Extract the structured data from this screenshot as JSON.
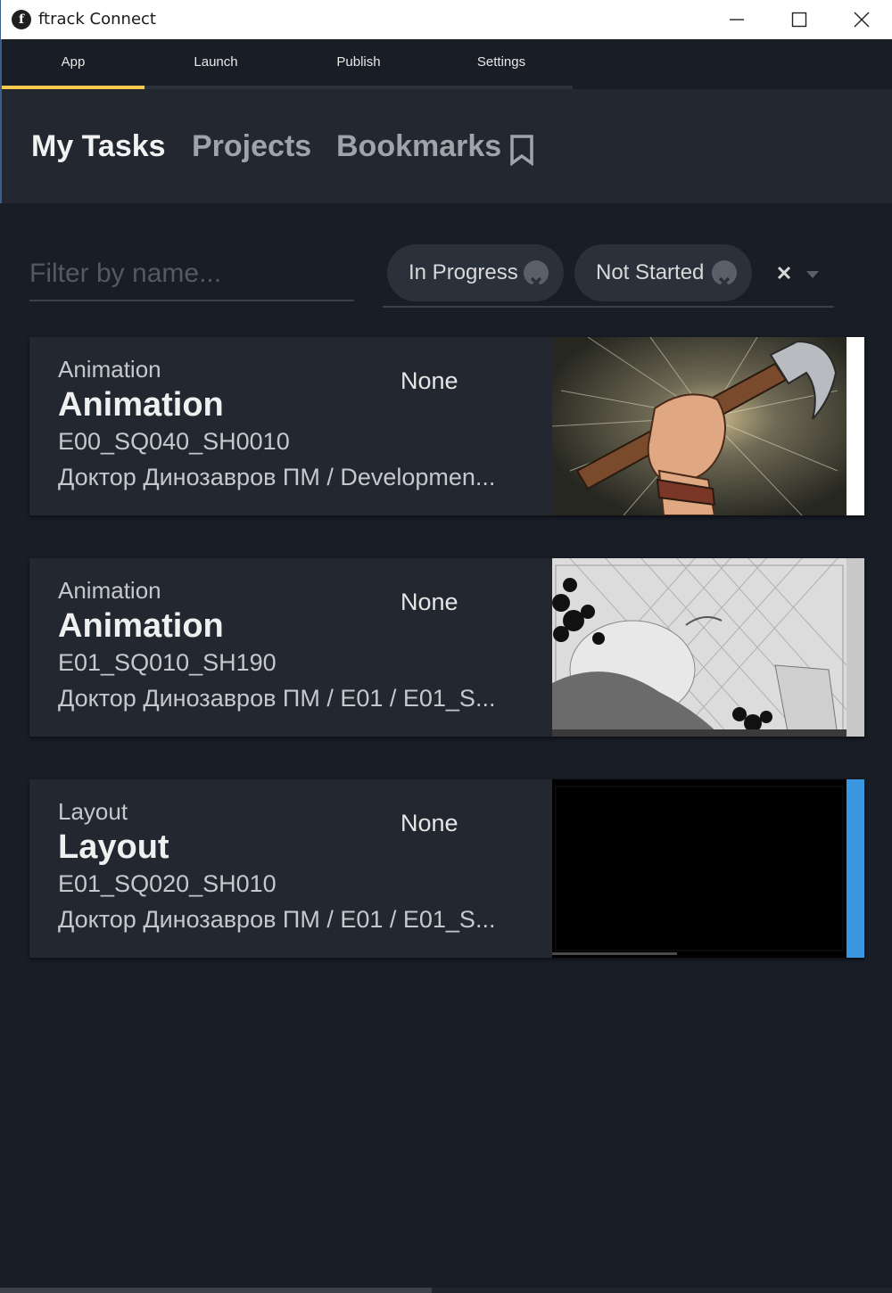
{
  "window": {
    "title": "ftrack Connect",
    "logo_letter": "f"
  },
  "tabs": [
    {
      "label": "App",
      "active": true
    },
    {
      "label": "Launch",
      "active": false
    },
    {
      "label": "Publish",
      "active": false
    },
    {
      "label": "Settings",
      "active": false
    }
  ],
  "subtabs": {
    "my_tasks": "My Tasks",
    "projects": "Projects",
    "bookmarks": "Bookmarks"
  },
  "filter": {
    "placeholder": "Filter by name...",
    "value": ""
  },
  "status_filters": [
    {
      "label": "In Progress"
    },
    {
      "label": "Not Started"
    }
  ],
  "tasks": [
    {
      "type": "Animation",
      "name": "Animation",
      "shot": "E00_SQ040_SH0010",
      "path": "Доктор Динозавров ПМ / Developmen...",
      "assignee": "None",
      "status_color": "#ffffff",
      "thumbnail": "hammer-fist"
    },
    {
      "type": "Animation",
      "name": "Animation",
      "shot": "E01_SQ010_SH190",
      "path": "Доктор Динозавров ПМ / E01 / E01_S...",
      "assignee": "None",
      "status_color": "#c8c8c8",
      "thumbnail": "sketch-frame"
    },
    {
      "type": "Layout",
      "name": "Layout",
      "shot": "E01_SQ020_SH010",
      "path": "Доктор Динозавров ПМ / E01 / E01_S...",
      "assignee": "None",
      "status_color": "#3a97e0",
      "thumbnail": "black-frame"
    }
  ],
  "colors": {
    "accent": "#f7c94c",
    "background": "#181d26",
    "card": "#222730"
  }
}
